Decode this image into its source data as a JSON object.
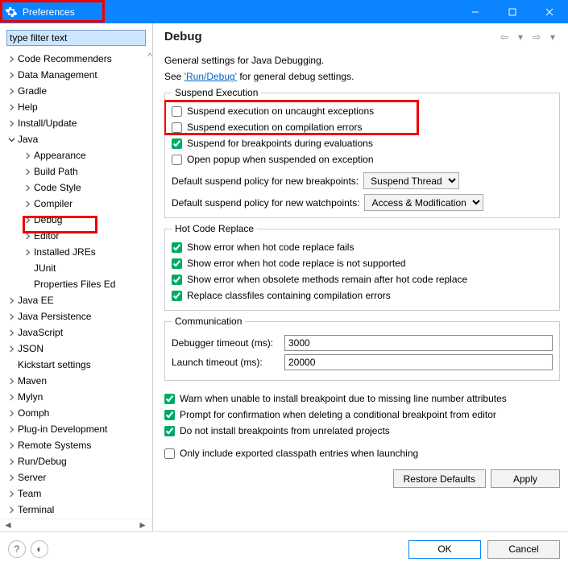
{
  "window": {
    "title": "Preferences"
  },
  "filter": {
    "placeholder": "type filter text",
    "value": "type filter text"
  },
  "tree": {
    "items": [
      {
        "label": "Code Recommenders",
        "ind": 1,
        "tw": "r",
        "cut": true
      },
      {
        "label": "Data Management",
        "ind": 1,
        "tw": "r"
      },
      {
        "label": "Gradle",
        "ind": 1,
        "tw": "r"
      },
      {
        "label": "Help",
        "ind": 1,
        "tw": "r"
      },
      {
        "label": "Install/Update",
        "ind": 1,
        "tw": "r"
      },
      {
        "label": "Java",
        "ind": 1,
        "tw": "d"
      },
      {
        "label": "Appearance",
        "ind": 2,
        "tw": "r"
      },
      {
        "label": "Build Path",
        "ind": 2,
        "tw": "r"
      },
      {
        "label": "Code Style",
        "ind": 2,
        "tw": "r"
      },
      {
        "label": "Compiler",
        "ind": 2,
        "tw": "r"
      },
      {
        "label": "Debug",
        "ind": 2,
        "tw": "r"
      },
      {
        "label": "Editor",
        "ind": 2,
        "tw": "r"
      },
      {
        "label": "Installed JREs",
        "ind": 2,
        "tw": "r"
      },
      {
        "label": "JUnit",
        "ind": 2,
        "tw": "none"
      },
      {
        "label": "Properties Files Ed",
        "ind": 2,
        "tw": "none",
        "cut": true
      },
      {
        "label": "Java EE",
        "ind": 1,
        "tw": "r"
      },
      {
        "label": "Java Persistence",
        "ind": 1,
        "tw": "r"
      },
      {
        "label": "JavaScript",
        "ind": 1,
        "tw": "r"
      },
      {
        "label": "JSON",
        "ind": 1,
        "tw": "r"
      },
      {
        "label": "Kickstart settings",
        "ind": 1,
        "tw": "none"
      },
      {
        "label": "Maven",
        "ind": 1,
        "tw": "r"
      },
      {
        "label": "Mylyn",
        "ind": 1,
        "tw": "r"
      },
      {
        "label": "Oomph",
        "ind": 1,
        "tw": "r"
      },
      {
        "label": "Plug-in Development",
        "ind": 1,
        "tw": "r"
      },
      {
        "label": "Remote Systems",
        "ind": 1,
        "tw": "r"
      },
      {
        "label": "Run/Debug",
        "ind": 1,
        "tw": "r"
      },
      {
        "label": "Server",
        "ind": 1,
        "tw": "r"
      },
      {
        "label": "Team",
        "ind": 1,
        "tw": "r"
      },
      {
        "label": "Terminal",
        "ind": 1,
        "tw": "r"
      }
    ]
  },
  "page": {
    "heading": "Debug",
    "intro": "General settings for Java Debugging.",
    "see_prefix": "See ",
    "see_link": "'Run/Debug'",
    "see_suffix": " for general debug settings.",
    "fs_suspend": "Suspend Execution",
    "chk_suspend_uncaught": "Suspend execution on uncaught exceptions",
    "chk_suspend_compile": "Suspend execution on compilation errors",
    "chk_suspend_bp": "Suspend for breakpoints during evaluations",
    "chk_open_popup": "Open popup when suspended on exception",
    "policy_bp_label": "Default suspend policy for new breakpoints:",
    "policy_bp_value": "Suspend Thread",
    "policy_wp_label": "Default suspend policy for new watchpoints:",
    "policy_wp_value": "Access & Modification",
    "fs_hot": "Hot Code Replace",
    "chk_hot_fail": "Show error when hot code replace fails",
    "chk_hot_nosup": "Show error when hot code replace is not supported",
    "chk_hot_obs": "Show error when obsolete methods remain after hot code replace",
    "chk_hot_replace": "Replace classfiles containing compilation errors",
    "fs_comm": "Communication",
    "dbg_timeout_label": "Debugger timeout (ms):",
    "dbg_timeout_value": "3000",
    "launch_timeout_label": "Launch timeout (ms):",
    "launch_timeout_value": "20000",
    "chk_warn_line": "Warn when unable to install breakpoint due to missing line number attributes",
    "chk_prompt_del": "Prompt for confirmation when deleting a conditional breakpoint from editor",
    "chk_no_unrelated": "Do not install breakpoints from unrelated projects",
    "chk_only_exported": "Only include exported classpath entries when launching",
    "btn_restore": "Restore Defaults",
    "btn_apply": "Apply"
  },
  "footer": {
    "ok": "OK",
    "cancel": "Cancel"
  }
}
